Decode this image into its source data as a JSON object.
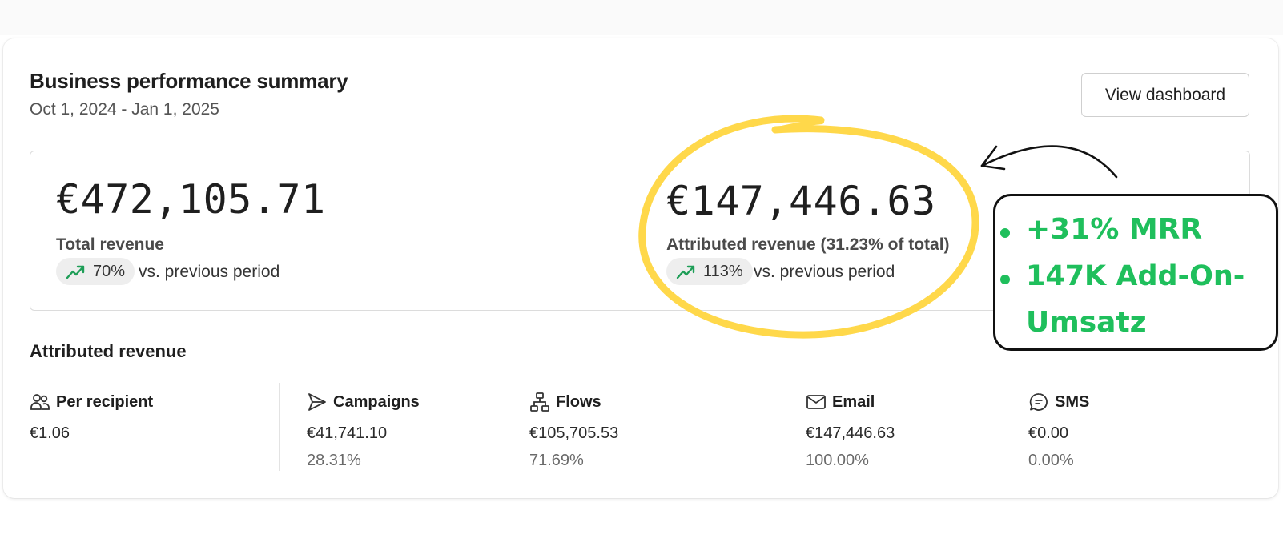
{
  "header": {
    "title": "Business performance summary",
    "date_range": "Oct 1, 2024 - Jan 1, 2025",
    "view_dashboard_label": "View dashboard"
  },
  "summary": {
    "total": {
      "value": "€472,105.71",
      "label": "Total revenue",
      "change": "70%",
      "comparison": "vs. previous period"
    },
    "attributed": {
      "value": "€147,446.63",
      "label": "Attributed revenue (31.23% of total)",
      "change": "113%",
      "comparison": "vs. previous period"
    }
  },
  "attributed_section": {
    "title": "Attributed revenue",
    "metrics": [
      {
        "label": "Per recipient",
        "icon": "people-icon",
        "value": "€1.06",
        "pct": ""
      },
      {
        "label": "Campaigns",
        "icon": "send-icon",
        "value": "€41,741.10",
        "pct": "28.31%"
      },
      {
        "label": "Flows",
        "icon": "flow-icon",
        "value": "€105,705.53",
        "pct": "71.69%"
      },
      {
        "label": "Email",
        "icon": "mail-icon",
        "value": "€147,446.63",
        "pct": "100.00%"
      },
      {
        "label": "SMS",
        "icon": "chat-icon",
        "value": "€0.00",
        "pct": "0.00%"
      }
    ]
  },
  "annotation": {
    "callout": {
      "line1": "+31% MRR",
      "line2a": "147K Add-On-",
      "line2b": "Umsatz"
    }
  },
  "colors": {
    "trend_green": "#1e9e57",
    "highlight_yellow": "#ffd84a",
    "callout_green": "#1fbf5c"
  }
}
